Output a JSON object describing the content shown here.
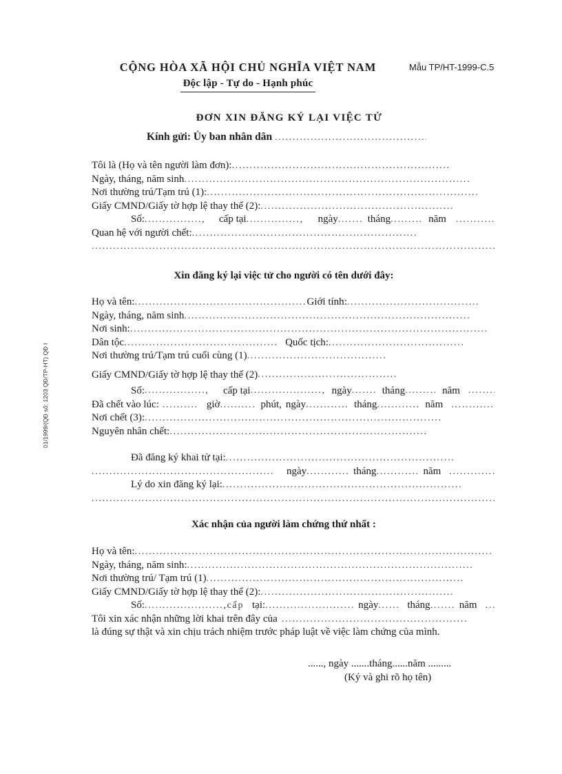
{
  "document": {
    "form_number": "Mẫu TP/HT-1999-C.5",
    "side_stamp": "01/1999/(QĐ số: 1203 QĐ/TP-HT) QĐ I",
    "republic_line1": "CỘNG HÒA XÃ HỘI CHỦ NGHĨA VIỆT NAM",
    "republic_line2": "Độc lập - Tự do - Hạnh phúc",
    "title": "ĐƠN XIN ĐĂNG KÝ LẠI VIỆC TỬ",
    "addressee_label": "Kính gửi: Ủy ban nhân dân",
    "addressee_dots": "................................................"
  },
  "applicant": {
    "rows": [
      {
        "label": "Tôi là (Họ và tên người làm đơn):",
        "dots": "......................................................................."
      },
      {
        "label": "Ngày, tháng, năm sinh",
        "dots": ".................................................................................."
      },
      {
        "label": "Nơi thường trú/Tạm trú (1):",
        "dots": "............................................................................."
      },
      {
        "label": "Giấy CMND/Giấy tờ hợp lệ thay thế (2):",
        "dots": "......................................................"
      }
    ],
    "id_row": {
      "so_label": "Số:",
      "so_dots": "................,",
      "captai_label": "cấp tại",
      "captai_dots": "...............,",
      "ngay_label": "ngày",
      "ngay_dots": ".......",
      "thang_label": "tháng",
      "thang_dots": ".........",
      "nam_label": "năm",
      "nam_dots": "..................."
    },
    "relation_row": {
      "label": "Quan hệ với người chết:",
      "dots": "..............................................................."
    },
    "relation_cont_dots": "................................................................................................................."
  },
  "deceased": {
    "section_title": "Xin đăng ký lại việc tử cho người có tên dưới đây:",
    "name_row": {
      "label": "Họ và tên:",
      "dots1": "..................................................",
      "gender_label": "Giới     tính:",
      "dots2": "................................................"
    },
    "rows": [
      {
        "label": "Ngày, tháng, năm sinh",
        "dots": "................................................................................."
      },
      {
        "label": "Nơi sinh:",
        "dots": "............................................................................................................"
      }
    ],
    "ethnic_row": {
      "label": "Dân tộc",
      "dots1": "...........................................",
      "nationality_label": "Quốc     tịch:",
      "dots2": "..............................................."
    },
    "residence_row": {
      "label": "Nơi thường trú/Tạm trú cuối cùng (1)",
      "dots": "......................................."
    },
    "id_row": {
      "label": "Giấy CMND/Giấy tờ hợp lệ thay thế (2)",
      "dots": "......................................."
    },
    "id_detail_row": {
      "so_label": "Số:",
      "so_dots": ".................,",
      "captai_label": "cấp tại",
      "captai_dots": "....................,",
      "ngay_label": "ngày",
      "ngay_dots": ".......",
      "thang_label": "tháng",
      "thang_dots": ".........",
      "nam_label": "năm",
      "nam_dots": "..................."
    },
    "death_time_row": {
      "label": "Đã chết vào lúc:",
      "dots0": "..........",
      "gio_label": "giờ",
      "gio_dots": "..........",
      "phut_label": "phút,",
      "ngay_label": "ngày",
      "ngay_dots": "............",
      "thang_label": "tháng",
      "thang_dots": "............",
      "nam_label": "năm",
      "nam_dots": "...................."
    },
    "death_place_row": {
      "label": "Nơi chết (3):",
      "dots": "..................................................................................."
    },
    "death_cause_row": {
      "label": "Nguyên nhân chết:",
      "dots": "........................................................................"
    }
  },
  "registration": {
    "registered_row": {
      "label": "Đã đăng ký khai tử tại:",
      "dots": "................................................................"
    },
    "registered_cont": {
      "dots1": "..............................................................,",
      "ngay_label": "ngày",
      "ngay_dots": "............",
      "thang_label": "tháng",
      "thang_dots": "............",
      "nam_label": "năm",
      "nam_dots": "................"
    },
    "reason_row": {
      "label": "Lý do xin đăng ký lại:",
      "dots": "..................................................................."
    },
    "reason_cont_dots": "................................................................................................................."
  },
  "witness": {
    "section_title": "Xác nhận của người làm chứng thứ nhất :",
    "rows": [
      {
        "label": "Họ và tên:",
        "dots": "............................................................................................................"
      },
      {
        "label": "Ngày, tháng, năm sinh:",
        "dots": "................................................................................"
      },
      {
        "label": "Nơi thường trú/ Tạm trú (1)",
        "dots": "........................................................................"
      },
      {
        "label": "Giấy CMND/Giấy tờ hợp lệ thay thế (2):",
        "dots": "......................................................"
      }
    ],
    "id_row": {
      "so_label": "Số:",
      "so_dots": "......................,cấp",
      "captai_label": "tại:",
      "captai_dots": "..............................,",
      "ngay_label": "ngày",
      "ngay_dots": "......",
      "thang_label": "tháng",
      "thang_dots": ".......",
      "nam_label": "năm",
      "nam_dots": ".........."
    },
    "confirm_line1": {
      "text": "Tôi xin  xác nhận những lời khai trên đây của",
      "dots": "......................................................"
    },
    "confirm_line2": "là đúng sự thật và xin chịu trách nhiệm trước pháp  luật về việc làm chứng của mình."
  },
  "signature": {
    "date_line": "......, ngày .......tháng......năm    .........",
    "sign_note": "(Ký và ghi rõ họ tên)"
  },
  "scan_edge": "································································································································································"
}
